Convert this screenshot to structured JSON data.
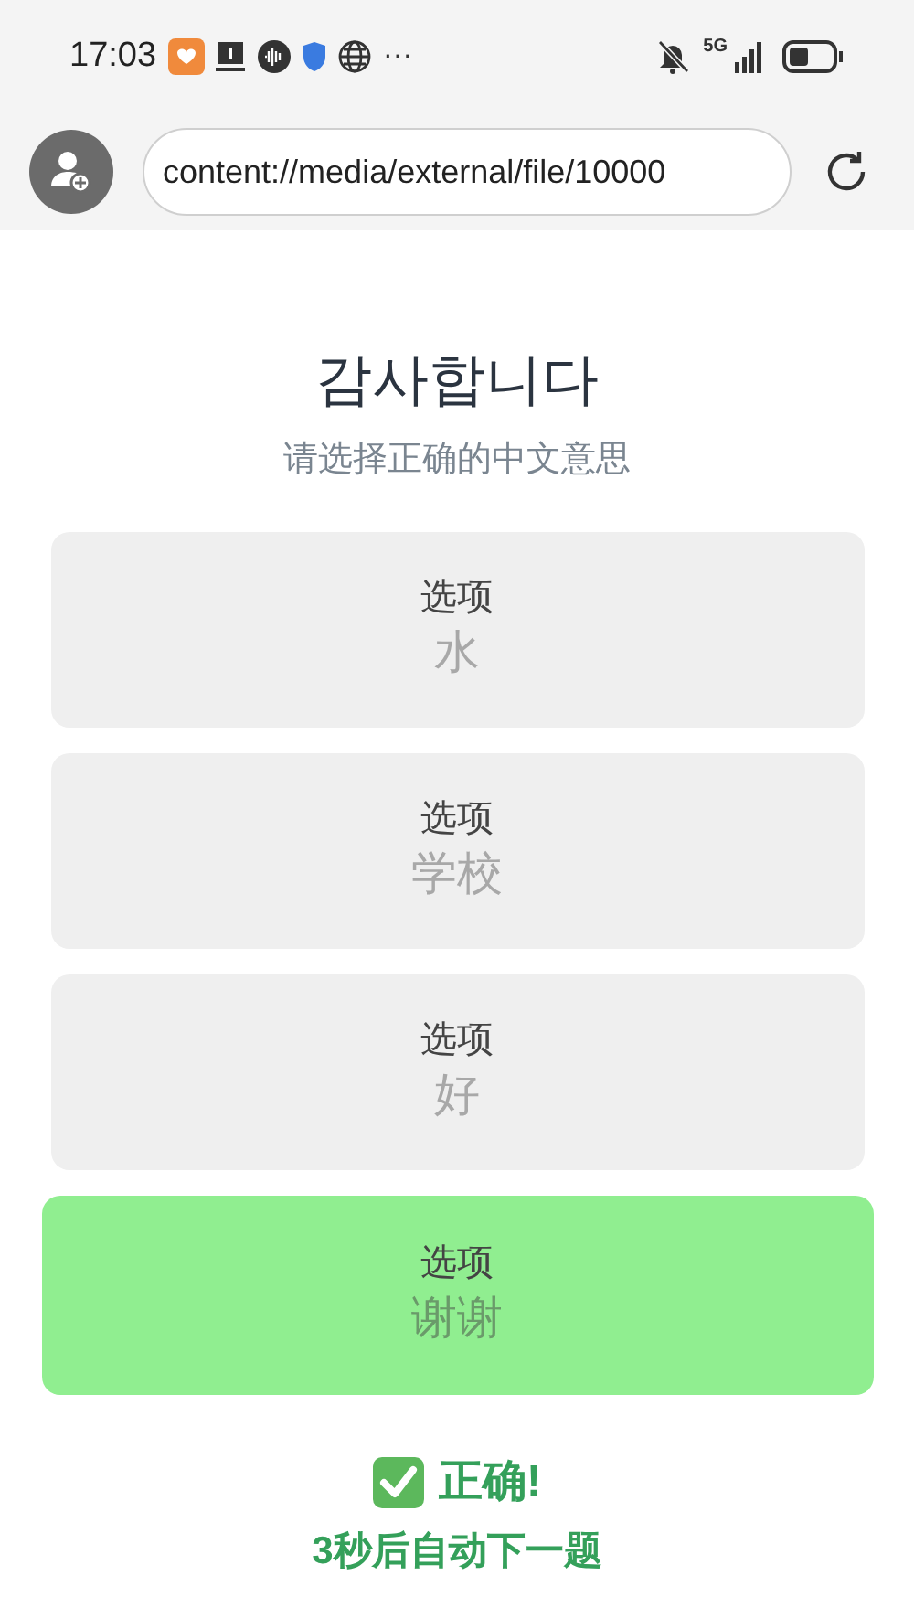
{
  "status_bar": {
    "time": "17:03",
    "more": "···",
    "network": "5G"
  },
  "browser": {
    "url": "content://media/external/file/10000"
  },
  "question": {
    "word": "감사합니다",
    "prompt": "请选择正确的中文意思"
  },
  "options": [
    {
      "label": "选项",
      "value": "水",
      "selected": false
    },
    {
      "label": "选项",
      "value": "学校",
      "selected": false
    },
    {
      "label": "选项",
      "value": "好",
      "selected": false
    },
    {
      "label": "选项",
      "value": "谢谢",
      "selected": true
    }
  ],
  "feedback": {
    "result": "正确!",
    "next": "3秒后自动下一题"
  }
}
